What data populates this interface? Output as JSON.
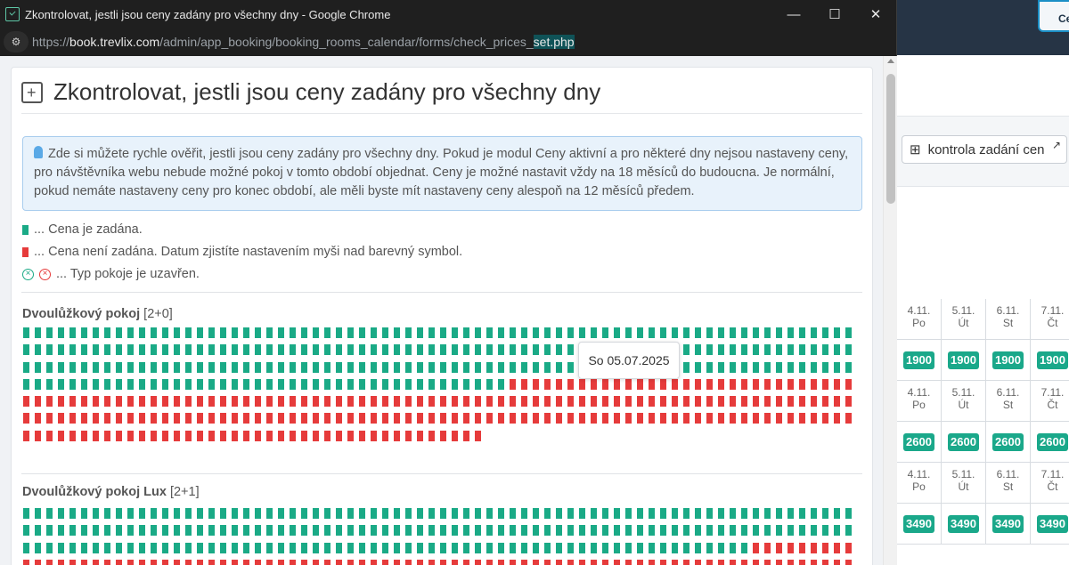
{
  "window": {
    "title": "Zkontrolovat, jestli jsou ceny zadány pro všechny dny - Google Chrome",
    "url_scheme": "https://",
    "url_host": "book.trevlix.com",
    "url_path": "/admin/app_booking/booking_rooms_calendar/forms/check_prices_",
    "url_highlight": "set.php",
    "minimize": "—",
    "maximize": "☐",
    "close": "✕"
  },
  "page": {
    "heading": "Zkontrolovat, jestli jsou ceny zadány pro všechny dny",
    "info": "Zde si můžete rychle ověřit, jestli jsou ceny zadány pro všechny dny. Pokud je modul Ceny aktivní a pro některé dny nejsou nastaveny ceny, pro návštěvníka webu nebude možné pokoj v tomto období objednat. Ceny je možné nastavit vždy na 18 měsíců do budoucna. Je normální, pokud nemáte nastaveny ceny pro konec období, ale měli byste mít nastaveny ceny alespoň na 12 měsíců předem.",
    "legend": {
      "set": "... Cena je zadána.",
      "not_set": "... Cena není zadána. Datum zjistíte nastavením myši nad barevný symbol.",
      "closed": "... Typ pokoje je uzavřen."
    },
    "rooms": [
      {
        "name": "Dvoulůžkový pokoj",
        "capacity": "[2+0]",
        "green_days": 258,
        "total_days": 472
      },
      {
        "name": "Dvoulůžkový pokoj Lux",
        "capacity": "[2+1]",
        "green_days": 207,
        "total_days": 288
      }
    ],
    "tooltip": "So 05.07.2025",
    "colors": {
      "set": "#1aaa86",
      "not_set": "#e63b3b"
    }
  },
  "background_app": {
    "top_button": "Ce",
    "check_button": "kontrola zadání cen",
    "days": [
      {
        "date": "4.11.",
        "dow": "Po"
      },
      {
        "date": "5.11.",
        "dow": "Út"
      },
      {
        "date": "6.11.",
        "dow": "St"
      },
      {
        "date": "7.11.",
        "dow": "Čt"
      }
    ],
    "prices": [
      "1900",
      "2600",
      "3490"
    ]
  }
}
